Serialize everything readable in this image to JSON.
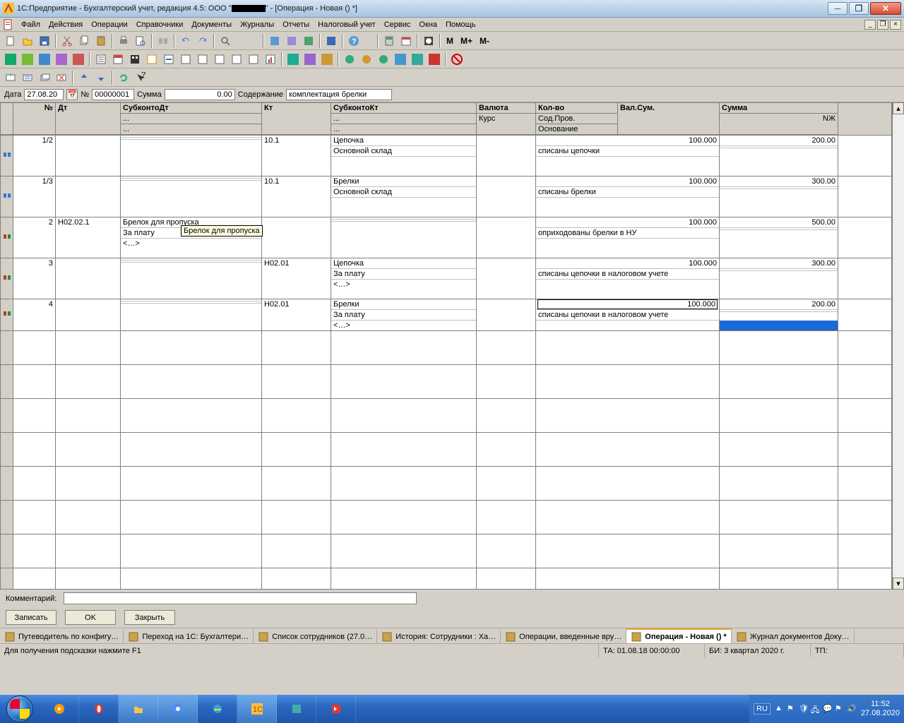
{
  "window": {
    "title_prefix": "1С:Предприятие - Бухгалтерский учет, редакция 4.5: ООО \"",
    "title_suffix": "\" - [Операция - Новая () *]"
  },
  "menu": [
    "Файл",
    "Действия",
    "Операции",
    "Справочники",
    "Документы",
    "Журналы",
    "Отчеты",
    "Налоговый учет",
    "Сервис",
    "Окна",
    "Помощь"
  ],
  "tb3": {
    "m": "M",
    "mplus": "M+",
    "mminus": "M-"
  },
  "form": {
    "date_lbl": "Дата",
    "date": "27.08.20",
    "no_lbl": "№",
    "no": "00000001",
    "sum_lbl": "Сумма",
    "sum": "0.00",
    "desc_lbl": "Содержание",
    "desc": "комплектация брелки"
  },
  "columns": {
    "no": "№",
    "dt": "Дт",
    "sdt": "СубконтоДт",
    "kt": "Кт",
    "skt": "СубконтоКт",
    "val": "Валюта",
    "kurs": "Курс",
    "qty": "Кол-во",
    "sod": "Сод.Пров.",
    "osn": "Основание",
    "vs": "Вал.Сум.",
    "sum": "Сумма",
    "nzh": "NЖ"
  },
  "rows": [
    {
      "ic": "blue",
      "no": "1/2",
      "dt": "",
      "sdt": [
        "",
        "",
        ""
      ],
      "kt": "10.1",
      "skt": [
        "Цепочка",
        "Основной склад",
        ""
      ],
      "val": "",
      "qty": "100.000",
      "vs": "",
      "sum": "200.00",
      "sod": "списаны цепочки"
    },
    {
      "ic": "blue",
      "no": "1/3",
      "dt": "",
      "sdt": [
        "",
        "",
        ""
      ],
      "kt": "10.1",
      "skt": [
        "Брелки",
        "Основной склад",
        ""
      ],
      "val": "",
      "qty": "100.000",
      "vs": "",
      "sum": "300.00",
      "sod": "списаны брелки"
    },
    {
      "ic": "red",
      "no": "2",
      "dt": "Н02.02.1",
      "sdt": [
        "Брелок для пропуска",
        "За плату",
        "<…>"
      ],
      "kt": "",
      "skt": [
        "",
        "",
        ""
      ],
      "val": "",
      "qty": "100.000",
      "vs": "",
      "sum": "500.00",
      "sod": "оприходованы брелки в НУ"
    },
    {
      "ic": "red",
      "no": "3",
      "dt": "",
      "sdt": [
        "",
        "",
        ""
      ],
      "kt": "Н02.01",
      "skt": [
        "Цепочка",
        "За плату",
        "<…>"
      ],
      "val": "",
      "qty": "100.000",
      "vs": "",
      "sum": "300.00",
      "sod": "списаны цепочки в налоговом учете"
    },
    {
      "ic": "red",
      "no": "4",
      "dt": "",
      "sdt": [
        "",
        "",
        ""
      ],
      "kt": "Н02.01",
      "skt": [
        "Брелки",
        "За плату",
        "<…>"
      ],
      "val": "",
      "qty": "100.000",
      "vs": "",
      "sum": "200.00",
      "sod": "списаны цепочки в налоговом учете",
      "active": true
    }
  ],
  "tooltip": "Брелок для пропуска",
  "dots": "...",
  "comment_lbl": "Комментарий:",
  "buttons": {
    "save": "Записать",
    "ok": "OK",
    "close": "Закрыть"
  },
  "tabs": [
    {
      "t": "Путеводитель по конфигу…"
    },
    {
      "t": "Переход на 1С: Бухгалтери…"
    },
    {
      "t": "Список сотрудников (27.0…"
    },
    {
      "t": "История: Сотрудники : Ха…"
    },
    {
      "t": "Операции, введенные вру…"
    },
    {
      "t": "Операция - Новая () *",
      "active": true
    },
    {
      "t": "Журнал документов  Доку…"
    }
  ],
  "status": {
    "hint": "Для получения подсказки нажмите F1",
    "ta": "ТА: 01.08.18  00:00:00",
    "bi": "БИ: 3 квартал 2020 г.",
    "tp": "ТП:"
  },
  "tray": {
    "lang": "RU",
    "time": "11:52",
    "date": "27.08.2020"
  }
}
